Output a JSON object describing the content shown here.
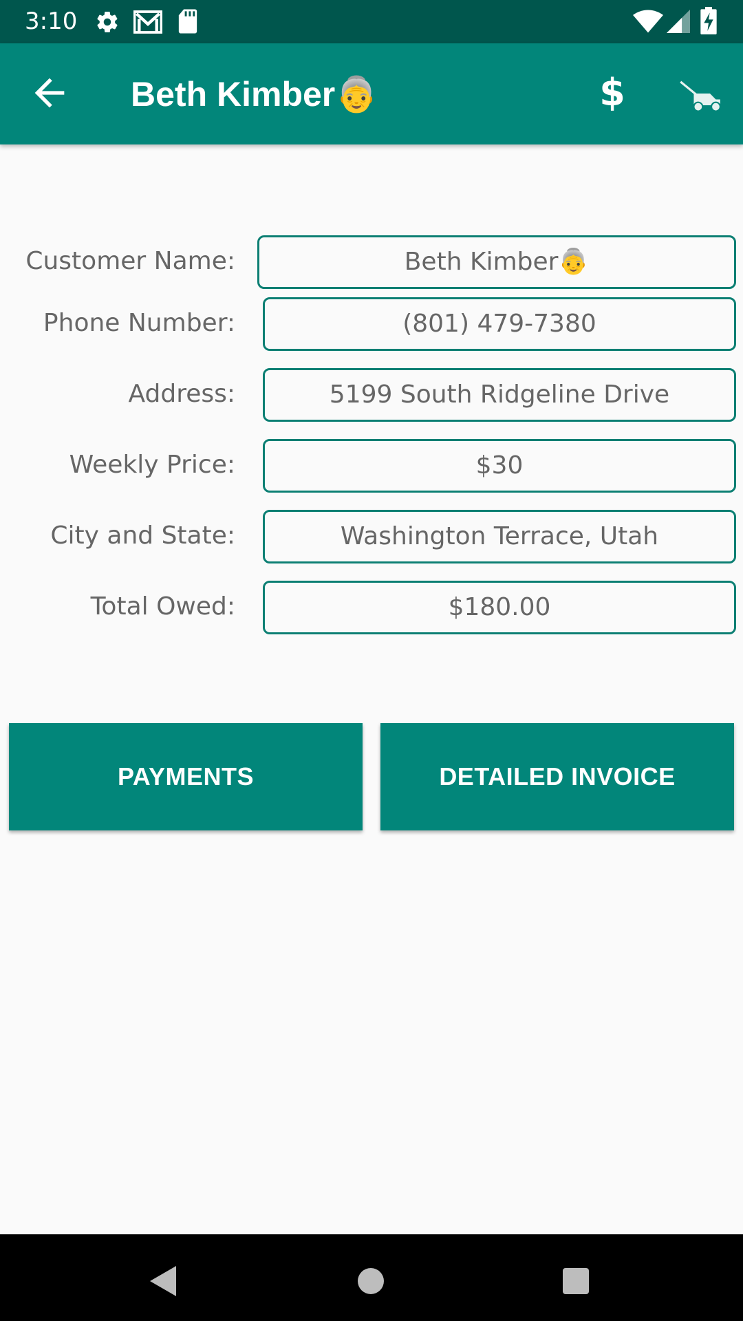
{
  "status_bar": {
    "time": "3:10",
    "icons": [
      "settings-icon",
      "gmail-icon",
      "sd-card-icon",
      "wifi-icon",
      "cell-signal-icon",
      "battery-charging-icon"
    ]
  },
  "app_bar": {
    "title": "Beth Kimber👵",
    "actions": [
      "back-arrow-icon",
      "dollar-icon",
      "lawn-mower-icon"
    ],
    "dollar_symbol": "$"
  },
  "form": {
    "customer_name": {
      "label": "Customer Name:",
      "value": "Beth Kimber👵"
    },
    "phone_number": {
      "label": "Phone Number:",
      "value": "(801) 479-7380"
    },
    "address": {
      "label": "Address:",
      "value": "5199 South Ridgeline Drive"
    },
    "weekly_price": {
      "label": "Weekly Price:",
      "value": "$30"
    },
    "city_state": {
      "label": "City and State:",
      "value": "Washington Terrace, Utah"
    },
    "total_owed": {
      "label": "Total Owed:",
      "value": "$180.00"
    }
  },
  "buttons": {
    "payments": "PAYMENTS",
    "detailed_invoice": "DETAILED INVOICE"
  },
  "colors": {
    "status_bar": "#00564d",
    "app_bar": "#02867a",
    "accent": "#0c7f73",
    "background": "#fafafa",
    "text_gray": "#666666"
  }
}
